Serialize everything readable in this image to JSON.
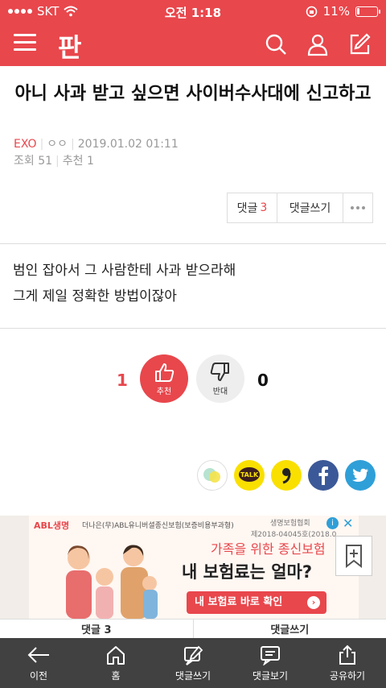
{
  "status": {
    "carrier": "SKT",
    "time": "오전 1:18",
    "battery_text": "11%",
    "battery_level": 0.11
  },
  "header": {
    "logo": "판",
    "icons": [
      "menu-icon",
      "search-icon",
      "user-icon",
      "edit-icon"
    ]
  },
  "post": {
    "title": "아니 사과 받고 싶으면 사이버수사대에 신고하고",
    "author": "EXO",
    "author_extra": "ㅇㅇ",
    "date": "2019.01.02 01:11",
    "views_label": "조회",
    "views": "51",
    "recommend_label": "추천",
    "recommend": "1",
    "body_lines": [
      "범인 잡아서 그 사람한테 사과 받으라해",
      "그게 제일 정확한 방법이잖아"
    ]
  },
  "comment_buttons": {
    "comments_label": "댓글",
    "comments_count": "3",
    "write_label": "댓글쓰기",
    "more_icon": "more-icon"
  },
  "votes": {
    "up_count": "1",
    "up_label": "추천",
    "down_count": "0",
    "down_label": "반대"
  },
  "share_icons": [
    "chat-bubble-icon",
    "kakaotalk-icon",
    "quote-icon",
    "facebook-icon",
    "twitter-icon"
  ],
  "ad": {
    "brand": "ABL생명",
    "line1": "더나은(무)ABL유니버셜종신보험(보증비용부과형)",
    "line2": "생명보험협회",
    "line3": "제2018-04045호(2018.0",
    "headline_small": "가족을 위한 종신보험",
    "headline": "내 보험료는 얼마?",
    "cta": "내 보험료 바로 확인",
    "bookmark_icon": "bookmark-add-icon"
  },
  "tabs2": {
    "left": "댓글 3",
    "right": "댓글쓰기"
  },
  "colors": {
    "accent": "#e8474c",
    "bottombar": "#414141"
  },
  "bottombar": [
    {
      "label": "이전",
      "icon": "back-arrow-icon"
    },
    {
      "label": "홈",
      "icon": "home-icon"
    },
    {
      "label": "댓글쓰기",
      "icon": "write-comment-icon"
    },
    {
      "label": "댓글보기",
      "icon": "view-comments-icon"
    },
    {
      "label": "공유하기",
      "icon": "share-icon"
    }
  ]
}
